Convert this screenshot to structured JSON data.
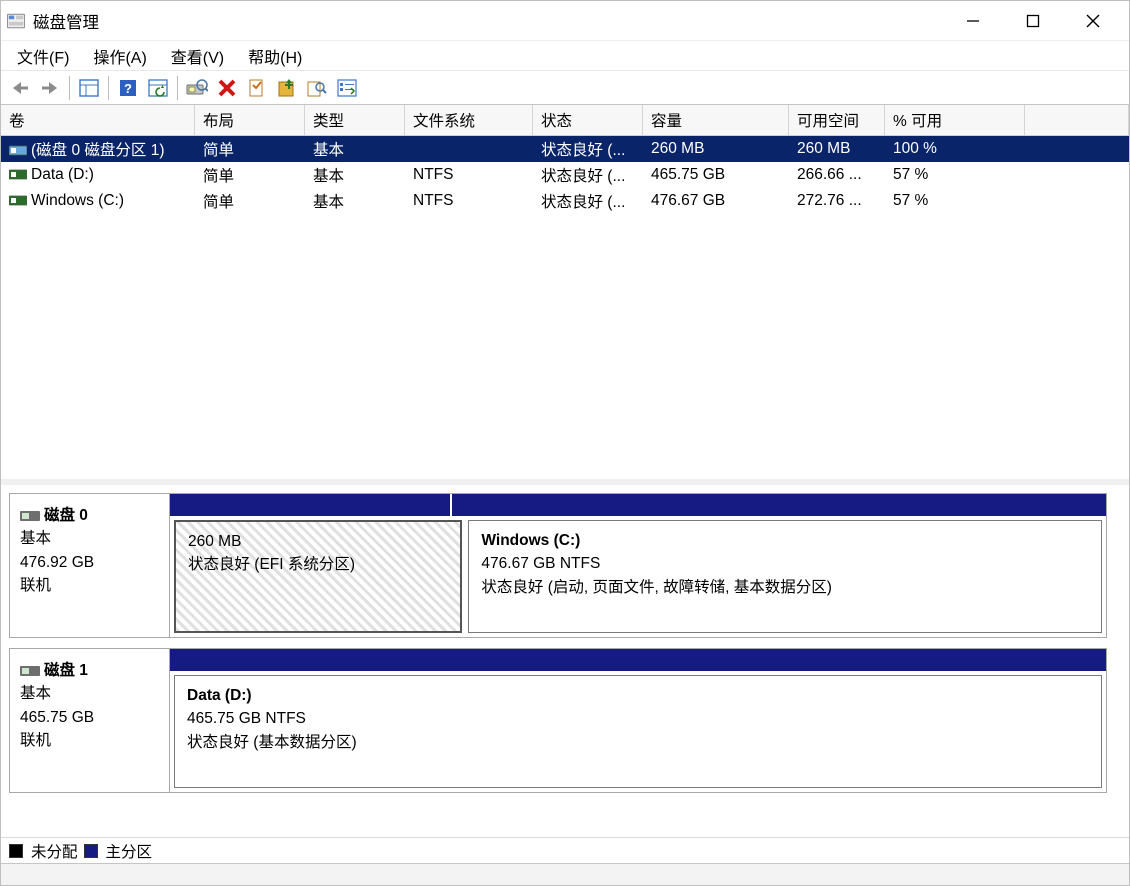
{
  "window": {
    "title": "磁盘管理"
  },
  "menu": {
    "file": "文件(F)",
    "action": "操作(A)",
    "view": "查看(V)",
    "help": "帮助(H)"
  },
  "volumes": {
    "headers": {
      "volume": "卷",
      "layout": "布局",
      "type": "类型",
      "filesystem": "文件系统",
      "status": "状态",
      "capacity": "容量",
      "free": "可用空间",
      "pct": "% 可用"
    },
    "rows": [
      {
        "volume": "(磁盘 0 磁盘分区 1)",
        "layout": "简单",
        "type": "基本",
        "fs": "",
        "status": "状态良好 (...",
        "capacity": "260 MB",
        "free": "260 MB",
        "pct": "100 %",
        "selected": true,
        "iconColor": "#6aa7dc"
      },
      {
        "volume": "Data (D:)",
        "layout": "简单",
        "type": "基本",
        "fs": "NTFS",
        "status": "状态良好 (...",
        "capacity": "465.75 GB",
        "free": "266.66 ...",
        "pct": "57 %",
        "selected": false,
        "iconColor": "#2c6b2c"
      },
      {
        "volume": "Windows (C:)",
        "layout": "简单",
        "type": "基本",
        "fs": "NTFS",
        "status": "状态良好 (...",
        "capacity": "476.67 GB",
        "free": "272.76 ...",
        "pct": "57 %",
        "selected": false,
        "iconColor": "#2c6b2c"
      }
    ]
  },
  "disks": [
    {
      "name": "磁盘 0",
      "type": "基本",
      "size": "476.92 GB",
      "state": "联机",
      "partitions": [
        {
          "title": "",
          "line2": "260 MB",
          "line3": "状态良好 (EFI 系统分区)",
          "stripFlex": 30,
          "bodyFlex": 30,
          "selected": true
        },
        {
          "title": "Windows  (C:)",
          "line2": "476.67 GB NTFS",
          "line3": "状态良好 (启动, 页面文件, 故障转储, 基本数据分区)",
          "stripFlex": 70,
          "bodyFlex": 70,
          "selected": false
        }
      ]
    },
    {
      "name": "磁盘 1",
      "type": "基本",
      "size": "465.75 GB",
      "state": "联机",
      "partitions": [
        {
          "title": "Data  (D:)",
          "line2": "465.75 GB NTFS",
          "line3": "状态良好 (基本数据分区)",
          "stripFlex": 100,
          "bodyFlex": 100,
          "selected": false
        }
      ]
    }
  ],
  "legend": {
    "unallocated": "未分配",
    "primary": "主分区"
  }
}
